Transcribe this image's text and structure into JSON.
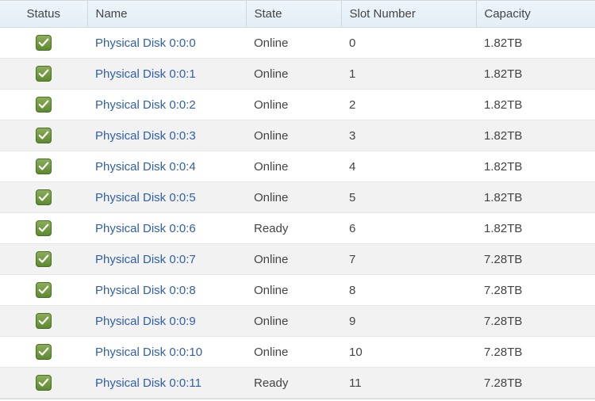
{
  "table": {
    "headers": {
      "status": "Status",
      "name": "Name",
      "state": "State",
      "slot": "Slot Number",
      "capacity": "Capacity"
    },
    "rows": [
      {
        "status_icon": "checkmark-icon",
        "name": "Physical Disk 0:0:0",
        "state": "Online",
        "slot": "0",
        "capacity": "1.82TB"
      },
      {
        "status_icon": "checkmark-icon",
        "name": "Physical Disk 0:0:1",
        "state": "Online",
        "slot": "1",
        "capacity": "1.82TB"
      },
      {
        "status_icon": "checkmark-icon",
        "name": "Physical Disk 0:0:2",
        "state": "Online",
        "slot": "2",
        "capacity": "1.82TB"
      },
      {
        "status_icon": "checkmark-icon",
        "name": "Physical Disk 0:0:3",
        "state": "Online",
        "slot": "3",
        "capacity": "1.82TB"
      },
      {
        "status_icon": "checkmark-icon",
        "name": "Physical Disk 0:0:4",
        "state": "Online",
        "slot": "4",
        "capacity": "1.82TB"
      },
      {
        "status_icon": "checkmark-icon",
        "name": "Physical Disk 0:0:5",
        "state": "Online",
        "slot": "5",
        "capacity": "1.82TB"
      },
      {
        "status_icon": "checkmark-icon",
        "name": "Physical Disk 0:0:6",
        "state": "Ready",
        "slot": "6",
        "capacity": "1.82TB"
      },
      {
        "status_icon": "checkmark-icon",
        "name": "Physical Disk 0:0:7",
        "state": "Online",
        "slot": "7",
        "capacity": "7.28TB"
      },
      {
        "status_icon": "checkmark-icon",
        "name": "Physical Disk 0:0:8",
        "state": "Online",
        "slot": "8",
        "capacity": "7.28TB"
      },
      {
        "status_icon": "checkmark-icon",
        "name": "Physical Disk 0:0:9",
        "state": "Online",
        "slot": "9",
        "capacity": "7.28TB"
      },
      {
        "status_icon": "checkmark-icon",
        "name": "Physical Disk 0:0:10",
        "state": "Online",
        "slot": "10",
        "capacity": "7.28TB"
      },
      {
        "status_icon": "checkmark-icon",
        "name": "Physical Disk 0:0:11",
        "state": "Ready",
        "slot": "11",
        "capacity": "7.28TB"
      }
    ]
  }
}
